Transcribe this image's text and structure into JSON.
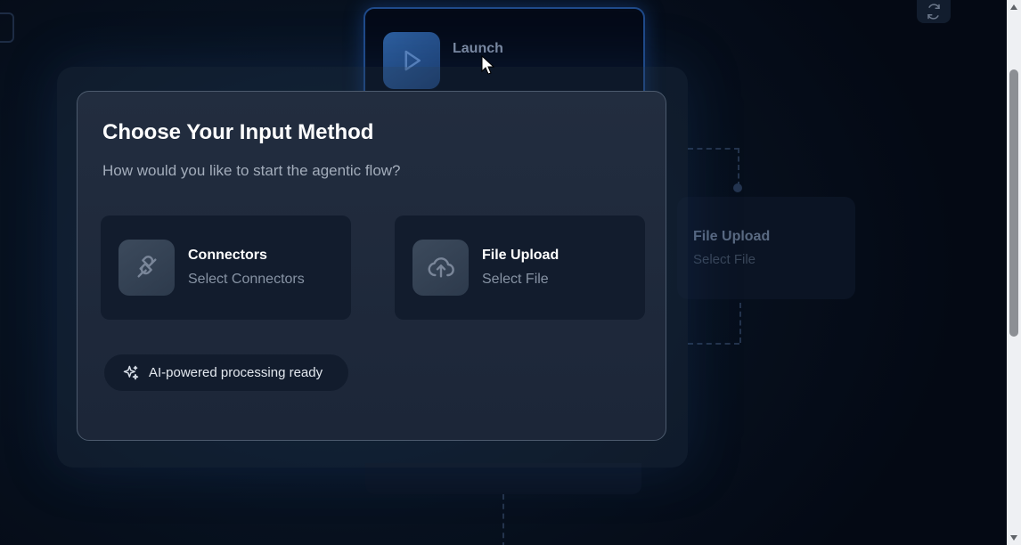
{
  "canvas": {
    "launch_node": {
      "title": "Launch",
      "icon": "play-icon"
    },
    "upload_node": {
      "title": "File Upload",
      "subtitle": "Select File"
    },
    "refresh_icon": "refresh-icon"
  },
  "modal": {
    "title": "Choose Your Input Method",
    "subtitle": "How would you like to start the agentic flow?",
    "options": [
      {
        "title": "Connectors",
        "subtitle": "Select Connectors",
        "icon": "plug-icon"
      },
      {
        "title": "File Upload",
        "subtitle": "Select File",
        "icon": "cloud-upload-icon"
      }
    ],
    "status_badge": {
      "text": "AI-powered processing ready",
      "icon": "sparkles-icon"
    }
  },
  "colors": {
    "background": "#050b1a",
    "modal_bg": "#1f293b",
    "card_bg": "#121c2d",
    "accent_blue": "#2d5f9f",
    "title_text": "#ffffff",
    "muted_text": "#8793a4"
  }
}
